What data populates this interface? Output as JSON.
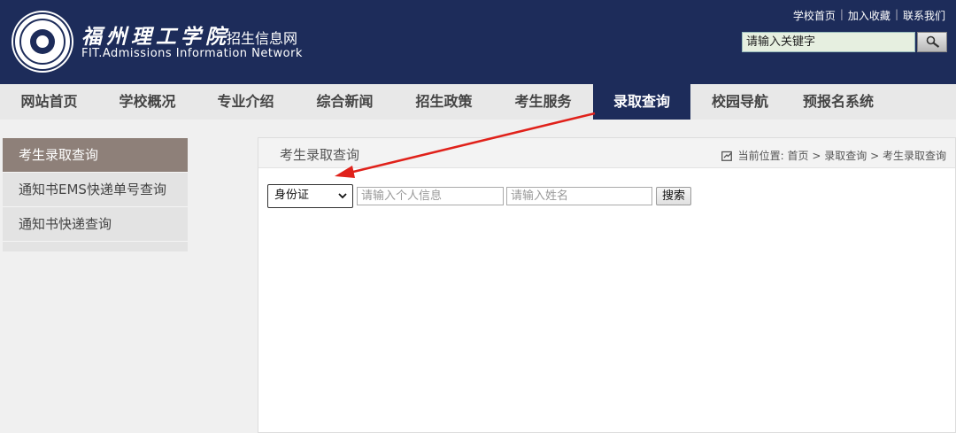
{
  "header": {
    "school_name": "福州理工学院",
    "site_name": "招生信息网",
    "english_name": "FIT.Admissions Information Network",
    "top_links": [
      "学校首页",
      "加入收藏",
      "联系我们"
    ],
    "search_placeholder": "请输入关键字"
  },
  "nav": {
    "items": [
      {
        "label": "网站首页"
      },
      {
        "label": "学校概况"
      },
      {
        "label": "专业介绍"
      },
      {
        "label": "综合新闻"
      },
      {
        "label": "招生政策"
      },
      {
        "label": "考生服务"
      },
      {
        "label": "录取查询",
        "active": true
      },
      {
        "label": "校园导航"
      },
      {
        "label": "预报名系统"
      }
    ]
  },
  "sidebar": {
    "items": [
      {
        "label": "考生录取查询",
        "active": true
      },
      {
        "label": "通知书EMS快递单号查询"
      },
      {
        "label": "通知书快递查询"
      }
    ]
  },
  "main": {
    "title": "考生录取查询",
    "breadcrumb_prefix": "当前位置:",
    "breadcrumb": [
      "首页",
      "录取查询",
      "考生录取查询"
    ],
    "breadcrumb_sep": ">",
    "form": {
      "id_type_selected": "身份证",
      "info_placeholder": "请输入个人信息",
      "name_placeholder": "请输入姓名",
      "search_label": "搜索"
    }
  },
  "colors": {
    "header_bg": "#1d2c5a",
    "sidebar_active": "#8e8079",
    "annotation_arrow": "#e0211a"
  }
}
